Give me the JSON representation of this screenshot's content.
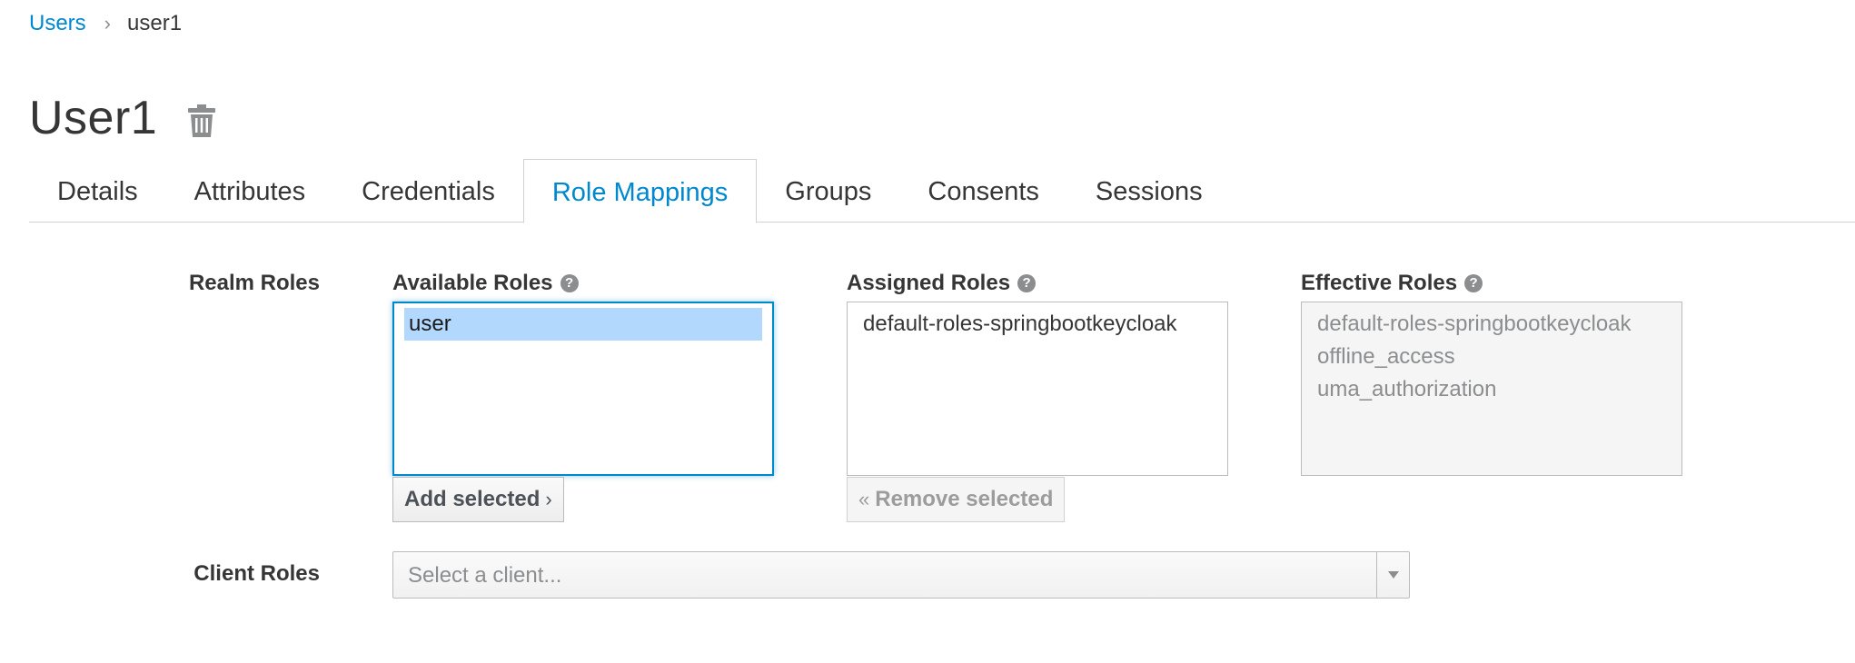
{
  "breadcrumb": {
    "parent": "Users",
    "separator": "›",
    "current": "user1"
  },
  "page": {
    "title": "User1",
    "delete_icon": "trash-icon"
  },
  "tabs": [
    {
      "label": "Details",
      "active": false
    },
    {
      "label": "Attributes",
      "active": false
    },
    {
      "label": "Credentials",
      "active": false
    },
    {
      "label": "Role Mappings",
      "active": true
    },
    {
      "label": "Groups",
      "active": false
    },
    {
      "label": "Consents",
      "active": false
    },
    {
      "label": "Sessions",
      "active": false
    }
  ],
  "realm_roles": {
    "label": "Realm Roles",
    "available": {
      "label": "Available Roles",
      "help_icon": "?",
      "options": [
        "user"
      ],
      "selected": "user"
    },
    "assigned": {
      "label": "Assigned Roles",
      "help_icon": "?",
      "options": [
        "default-roles-springbootkeycloak"
      ]
    },
    "effective": {
      "label": "Effective Roles",
      "help_icon": "?",
      "options": [
        "default-roles-springbootkeycloak",
        "offline_access",
        "uma_authorization"
      ]
    },
    "add_button": {
      "label": "Add selected",
      "icon": "›"
    },
    "remove_button": {
      "label": "Remove selected",
      "icon": "«"
    }
  },
  "client_roles": {
    "label": "Client Roles",
    "select_placeholder": "Select a client..."
  },
  "colors": {
    "link": "#0088ce",
    "selected_option": "#b3d8fd",
    "focus_border": "#0088ce"
  }
}
